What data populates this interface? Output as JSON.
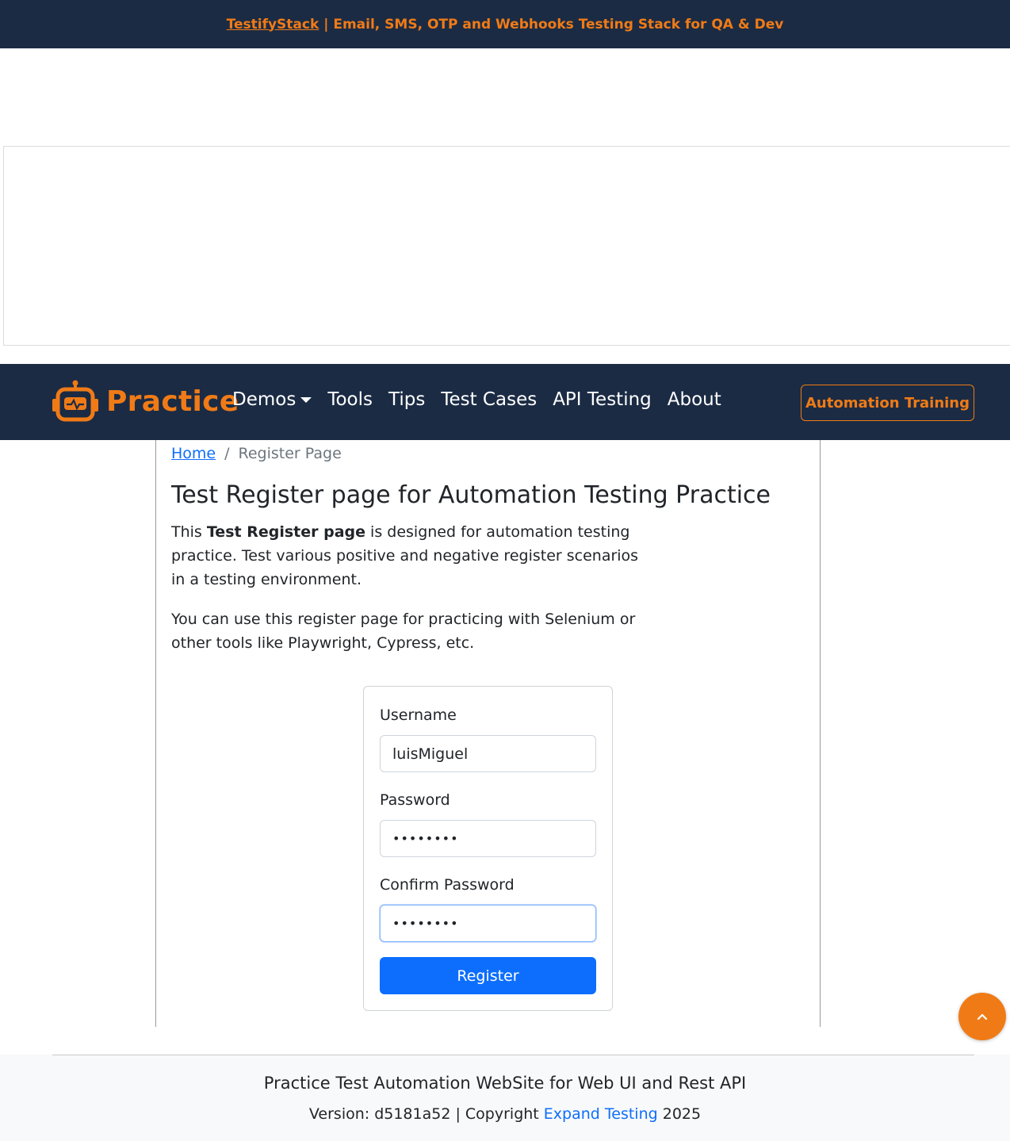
{
  "banner": {
    "link_text": "TestifyStack",
    "text": " | Email, SMS, OTP and Webhooks Testing Stack for QA & Dev"
  },
  "navbar": {
    "brand": "Practice",
    "items": [
      {
        "label": "Demos",
        "has_dropdown": true
      },
      {
        "label": "Tools"
      },
      {
        "label": "Tips"
      },
      {
        "label": "Test Cases"
      },
      {
        "label": "API Testing"
      },
      {
        "label": "About"
      }
    ],
    "cta_label": "Automation Training"
  },
  "breadcrumb": {
    "home": "Home",
    "separator": "/",
    "current": "Register Page"
  },
  "page": {
    "title": "Test Register page for Automation Testing Practice",
    "intro_before": "This ",
    "intro_bold": "Test Register page",
    "intro_after": " is designed for automation testing practice. Test various positive and negative register scenarios in a testing environment.",
    "intro2": "You can use this register page for practicing with Selenium or other tools like Playwright, Cypress, etc."
  },
  "form": {
    "username_label": "Username",
    "username_value": "luisMiguel",
    "password_label": "Password",
    "password_value": "••••••••",
    "confirm_label": "Confirm Password",
    "confirm_value": "••••••••",
    "submit_label": "Register"
  },
  "footer": {
    "title": "Practice Test Automation WebSite for Web UI and Rest API",
    "version_prefix": "Version: d5181a52 | Copyright ",
    "link_text": "Expand Testing",
    "year": " 2025"
  },
  "colors": {
    "navy": "#1b2b44",
    "orange": "#f07b16",
    "primary": "#0d6efd"
  },
  "icons": {
    "brand": "robot-logo-icon",
    "dropdown": "caret-down-icon",
    "scroll": "chevron-up-icon"
  }
}
